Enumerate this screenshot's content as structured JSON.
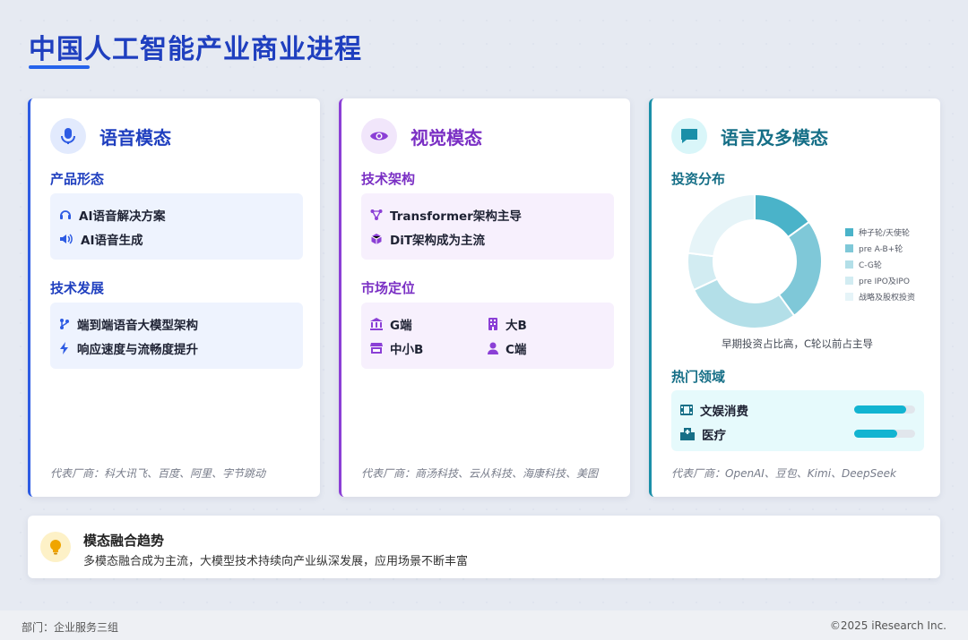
{
  "title": "中国人工智能产业商业进程",
  "voice": {
    "title": "语音模态",
    "sec1": "产品形态",
    "items1": [
      "AI语音解决方案",
      "AI语音生成"
    ],
    "sec2": "技术发展",
    "items2": [
      "端到端语音大模型架构",
      "响应速度与流畅度提升"
    ],
    "footer": "代表厂商：科大讯飞、百度、阿里、字节跳动"
  },
  "vision": {
    "title": "视觉模态",
    "sec1": "技术架构",
    "items1": [
      "Transformer架构主导",
      "DiT架构成为主流"
    ],
    "sec2": "市场定位",
    "market": [
      "G端",
      "大B",
      "中小B",
      "C端"
    ],
    "footer": "代表厂商：商汤科技、云从科技、海康科技、美图"
  },
  "lang": {
    "title": "语言及多模态",
    "sec1": "投资分布",
    "note": "早期投资占比高，C轮以前占主导",
    "sec2": "热门领域",
    "hot": [
      {
        "label": "文娱消费",
        "value": 0.85
      },
      {
        "label": "医疗",
        "value": 0.7
      }
    ],
    "footer": "代表厂商：OpenAI、豆包、Kimi、DeepSeek"
  },
  "chart_data": {
    "type": "pie",
    "title": "",
    "categories": [
      "种子轮/天使轮",
      "pre A-B+轮",
      "C-G轮",
      "pre IPO及IPO",
      "战略及股权投资"
    ],
    "values": [
      15,
      25,
      28,
      9,
      23
    ],
    "colors": [
      "#4ab3c9",
      "#7fc8d8",
      "#b3dfe8",
      "#d2ecf2",
      "#e6f4f8"
    ],
    "legend_position": "right"
  },
  "trend": {
    "title": "模态融合趋势",
    "desc": "多模态融合成为主流，大模型技术持续向产业纵深发展，应用场景不断丰富"
  },
  "footer": {
    "left": "部门：企业服务三组",
    "right": "©2025 iResearch Inc."
  },
  "colors": {
    "voice": "#2d5be3",
    "vision": "#8b3fd6",
    "lang": "#1a8fa8"
  }
}
